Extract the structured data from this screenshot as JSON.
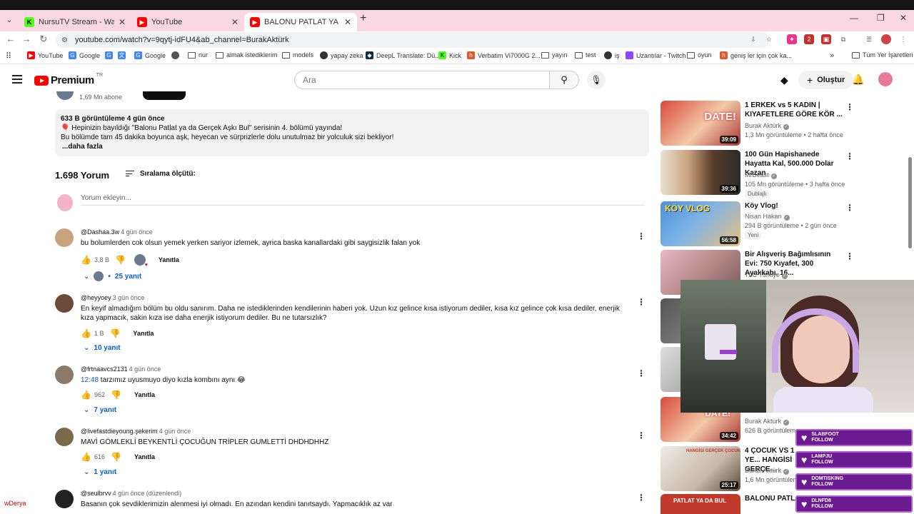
{
  "browser": {
    "tabs": [
      {
        "title": "NursuTV Stream - Watch Live o",
        "icon": "kick-icon",
        "color": "#53fc18"
      },
      {
        "title": "YouTube",
        "icon": "youtube-icon",
        "color": "#ff0000"
      },
      {
        "title": "BALONU PATLAT YA DA GERÇE",
        "icon": "youtube-icon",
        "color": "#ff0000"
      }
    ],
    "url": "youtube.com/watch?v=9qytj-idFU4&ab_channel=BurakAktürk",
    "bookmarks": [
      "YouTube",
      "Google",
      "Google",
      "nur",
      "almak istediklerim",
      "models",
      "yapay zeka",
      "DeepL Translate: Dü...",
      "Kick",
      "Verbatim Vi7000G 2...",
      "yayın",
      "test",
      "iş",
      "Uzantılar - Twitch",
      "oyun",
      "geniş ler için çok ka...",
      "Tüm Yer İşaretleri"
    ],
    "ext_badge": "2"
  },
  "youtube": {
    "logo_text": "Premium",
    "region": "TR",
    "search_placeholder": "Ara",
    "create_label": "Oluştur"
  },
  "channel": {
    "subscribers": "1,69 Mn abone"
  },
  "description": {
    "meta": "633 B görüntüleme  4 gün önce",
    "line1": "🎈 Hepinizin bayıldığı \"Balonu Patlat ya da Gerçek Aşkı Bul\" serisinin 4. bölümü yayında!",
    "line2": "Bu bölümde tam 45 dakika boyunca aşk, heyecan ve sürprizlerle dolu unutulmaz bir yolculuk sizi bekliyor!",
    "more": "...daha fazla"
  },
  "comments_header": {
    "count": "1.698 Yorum",
    "sort_label": "Sıralama ölçütü:",
    "add_placeholder": "Yorum ekleyin..."
  },
  "comments": [
    {
      "user": "@Dashaa.3w",
      "time": "4 gün önce",
      "text": "bu bolumlerden cok olsun yemek yerken sariyor izlemek, ayrica baska kanallardaki gibi saygisizlik falan yok",
      "likes": "3,8 B",
      "reply": "Yanıtla",
      "replies": "25 yanıt",
      "avatar": "#c9a27e"
    },
    {
      "user": "@heyyoey",
      "time": "3 gün önce",
      "text": "En keyif almadığım bölüm bu oldu sanırım. Daha ne istediklerinden kendilerinin haberi yok. Uzun kız gelince kısa istiyorum dediler, kısa kız gelince çok kısa dediler, enerjik kıza yapmacık, sakin kıza ise daha enerjik istiyorum dediler. Bu ne tutarsızlık?",
      "likes": "1 B",
      "reply": "Yanıtla",
      "replies": "10 yanıt",
      "avatar": "#6b4a3a"
    },
    {
      "user": "@frtnaavcs2131",
      "time": "4 gün önce",
      "timestamp": "12:48",
      "text": " tarzımız uyusmuyo diyo kızla kombını aynı 😂",
      "likes": "962",
      "reply": "Yanıtla",
      "replies": "7 yanıt",
      "avatar": "#8a7a6a"
    },
    {
      "user": "@livefastdieyoung.şekerim",
      "time": "4 gün önce",
      "text": "MAVİ GÖMLEKLİ BEYKENTLİ ÇOCUĞUN TRİPLER GUMLETTİ DHDHDHHZ",
      "likes": "616",
      "reply": "Yanıtla",
      "replies": "1 yanıt",
      "avatar": "#7a6a4a"
    },
    {
      "user": "@seulbrvv",
      "time": "4 gün önce (düzenlendi)",
      "text": "Basanın çok sevdiklerimizin alenmesi iyi olmadı. En azından kendini tanıtsaydı. Yapmacıklık az var",
      "avatar": "#222222"
    }
  ],
  "sidebar": [
    {
      "title": "1 ERKEK vs 5 KADIN | KIYAFETLERE GÖRE KÖR ...",
      "channel": "Burak Aktürk",
      "stats": "1,3 Mn görüntüleme • 2 hafta önce",
      "duration": "39:09",
      "thumb_text": "DATE!"
    },
    {
      "title": "100 Gün Hapishanede Hayatta Kal, 500.000 Dolar Kazan",
      "channel": "MrBeast",
      "stats": "105 Mn görüntüleme • 3 hafta önce",
      "duration": "39:36",
      "badge": "Dublajlı"
    },
    {
      "title": "Köy Vlog!",
      "channel": "Nisan Hakan",
      "stats": "294 B görüntüleme • 2 gün önce",
      "duration": "56:58",
      "badge": "Yeni",
      "thumb_text": "KÖY VLOG"
    },
    {
      "title": "Bir Alışveriş Bağımlısının Evi: 750 Kıyafet, 300 Ayakkabı, 16...",
      "channel": "TLC Türkiye"
    },
    {
      "channel": "Burak Aktürk",
      "stats": "626 B görüntüleme",
      "duration": "34:42",
      "thumb_text": "DATE!"
    },
    {
      "title": "4 ÇOCUK VS 1 YE... HANGİSİ GERÇE...",
      "channel": "Burak Aktürk",
      "stats": "1,6 Mn görüntüleme",
      "duration": "25:17",
      "thumb_text": "HANGİSİ GERÇEK ÇOCUK"
    },
    {
      "title": "BALONU PATLAT",
      "thumb_text": "PATLAT YA DA BUL"
    }
  ],
  "overlay": {
    "follows": [
      {
        "name": "SLABFOOT",
        "action": "FOLLOW"
      },
      {
        "name": "LAMPJU",
        "action": "FOLLOW"
      },
      {
        "name": "DOMTISKING",
        "action": "FOLLOW"
      },
      {
        "name": "DLNFD8",
        "action": "FOLLOW"
      }
    ],
    "bottom_text": "wDerya"
  }
}
